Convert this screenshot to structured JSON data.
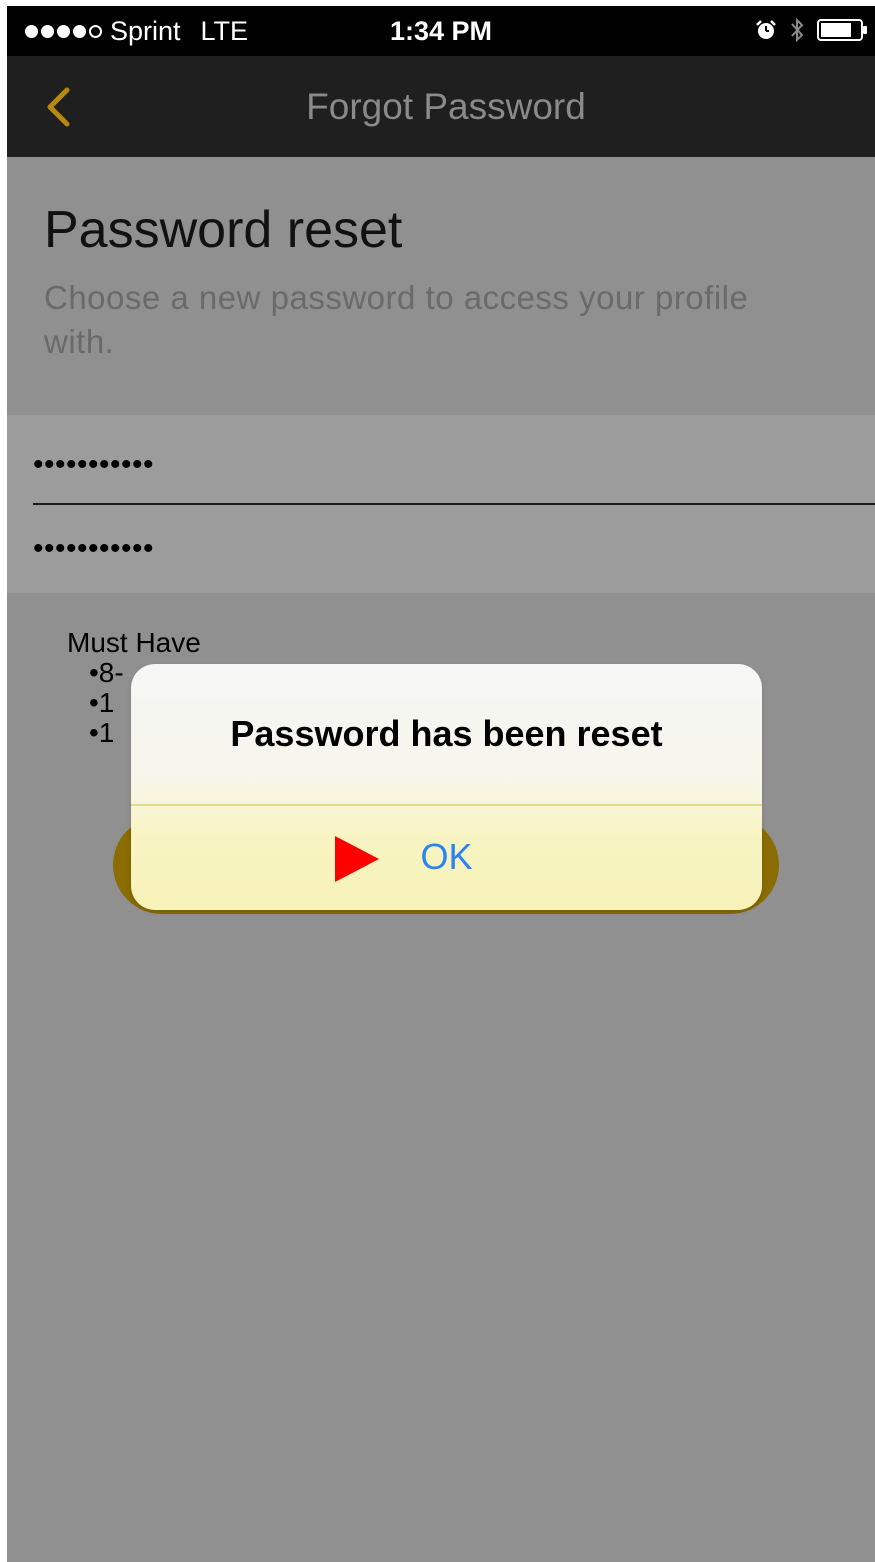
{
  "status_bar": {
    "carrier": "Sprint",
    "network": "LTE",
    "time": "1:34 PM",
    "signal_bars_filled": 4,
    "signal_bars_total": 5,
    "icons": [
      "alarm-icon",
      "bluetooth-icon",
      "battery-icon"
    ]
  },
  "nav": {
    "back_icon": "chevron-left-icon",
    "title": "Forgot Password",
    "accent_color": "#b8890a"
  },
  "page": {
    "heading": "Password reset",
    "subtitle": "Choose a new password to access your profile with."
  },
  "fields": {
    "new_password_value": "•••••••••••",
    "confirm_password_value": "•••••••••••"
  },
  "requirements": {
    "title": "Must Have",
    "items": [
      "•8-",
      "•1",
      "•1"
    ]
  },
  "alert": {
    "message": "Password has been reset",
    "ok_label": "OK",
    "ok_color": "#2a84f5",
    "indicator_icon": "play-icon",
    "indicator_color": "#ff0000"
  }
}
